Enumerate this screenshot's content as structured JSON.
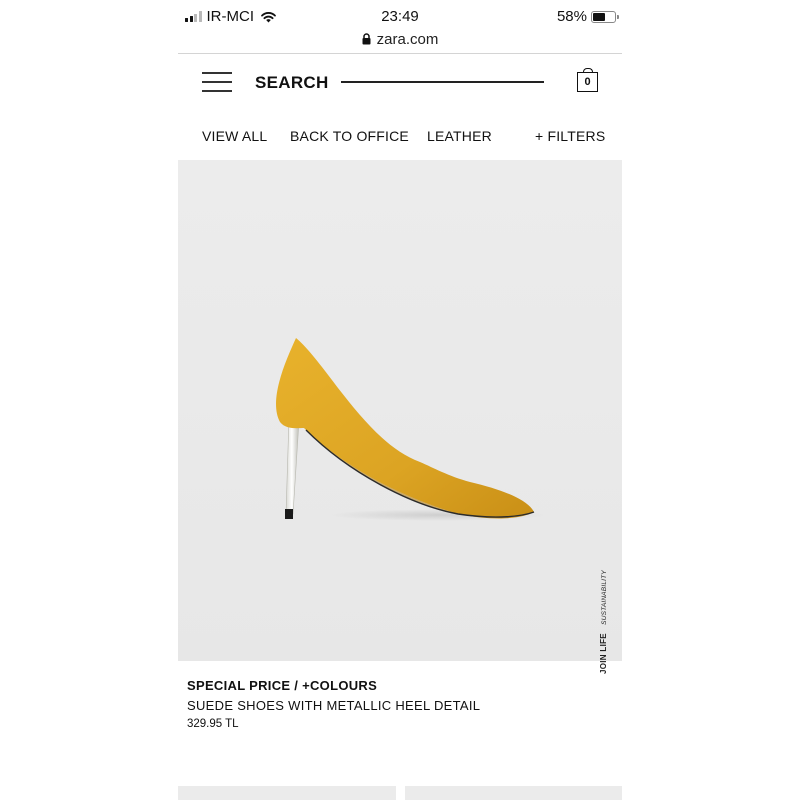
{
  "status_bar": {
    "carrier": "IR-MCI",
    "time": "23:49",
    "battery_percent": "58%",
    "battery_level": 0.58
  },
  "browser": {
    "url": "zara.com"
  },
  "header": {
    "search_label": "SEARCH",
    "bag_count": "0"
  },
  "category_nav": {
    "tabs": [
      "VIEW ALL",
      "BACK TO OFFICE",
      "LEATHER"
    ],
    "filters_label": "+ FILTERS"
  },
  "product": {
    "image_overlay": {
      "join_life": "JOIN LIFE",
      "sustainability": "SUSTAINABILITY"
    },
    "tag": "SPECIAL PRICE / +COLOURS",
    "name": "SUEDE SHOES WITH METALLIC HEEL DETAIL",
    "price": "329.95 TL",
    "color_hex": "#e0a823"
  },
  "icons": [
    "signal-icon",
    "wifi-icon",
    "battery-icon",
    "lock-icon",
    "menu-icon",
    "shopping-bag-icon"
  ]
}
